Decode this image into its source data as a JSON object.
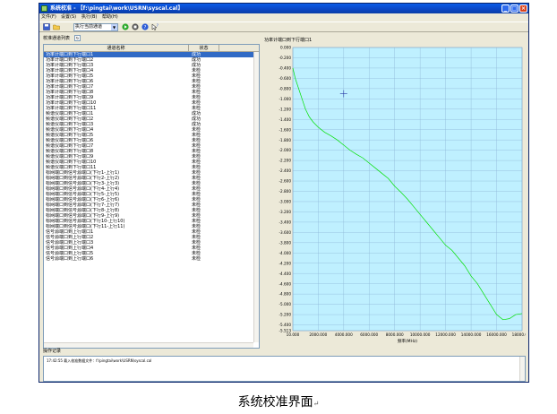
{
  "window": {
    "title": "系统校准 - 【f:\\pingtai\\work\\USRN\\syscal.cal】"
  },
  "menu": [
    {
      "label": "文件(F)"
    },
    {
      "label": "设置(S)"
    },
    {
      "label": "执行(B)"
    },
    {
      "label": "帮助(H)"
    }
  ],
  "toolbar": {
    "mode_value": "执行当前通道",
    "run_icon": "play-icon",
    "stop_icon": "stop-icon",
    "help_icon": "help-icon"
  },
  "list": {
    "group_label": "校准通道列表",
    "columns": {
      "name": "通道名称",
      "status": "状态"
    },
    "rows": [
      {
        "name": "功率计端口到下行端口1",
        "status": "成功"
      },
      {
        "name": "功率计端口到下行端口2",
        "status": "成功"
      },
      {
        "name": "功率计端口到下行端口3",
        "status": "成功"
      },
      {
        "name": "功率计端口到下行端口4",
        "status": "未检"
      },
      {
        "name": "功率计端口到下行端口5",
        "status": "未检"
      },
      {
        "name": "功率计端口到下行端口6",
        "status": "未检"
      },
      {
        "name": "功率计端口到下行端口7",
        "status": "未检"
      },
      {
        "name": "功率计端口到下行端口8",
        "status": "未检"
      },
      {
        "name": "功率计端口到下行端口9",
        "status": "未检"
      },
      {
        "name": "功率计端口到下行端口10",
        "status": "未检"
      },
      {
        "name": "功率计端口到下行端口11",
        "status": "未检"
      },
      {
        "name": "频谱仪端口到下行端口1",
        "status": "成功"
      },
      {
        "name": "频谱仪端口到下行端口2",
        "status": "成功"
      },
      {
        "name": "频谱仪端口到下行端口3",
        "status": "成功"
      },
      {
        "name": "频谱仪端口到下行端口4",
        "status": "未检"
      },
      {
        "name": "频谱仪端口到下行端口5",
        "status": "未检"
      },
      {
        "name": "频谱仪端口到下行端口6",
        "status": "未检"
      },
      {
        "name": "频谱仪端口到下行端口7",
        "status": "未检"
      },
      {
        "name": "频谱仪端口到下行端口8",
        "status": "未检"
      },
      {
        "name": "频谱仪端口到下行端口9",
        "status": "未检"
      },
      {
        "name": "频谱仪端口到下行端口10",
        "status": "未检"
      },
      {
        "name": "频谱仪端口到下行端口11",
        "status": "未检"
      },
      {
        "name": "标网端口到信号源端口(下行1-上行1)",
        "status": "未检"
      },
      {
        "name": "标网端口到信号源端口(下行2-上行2)",
        "status": "未检"
      },
      {
        "name": "标网端口到信号源端口(下行3-上行3)",
        "status": "未检"
      },
      {
        "name": "标网端口到信号源端口(下行4-上行4)",
        "status": "未检"
      },
      {
        "name": "标网端口到信号源端口(下行5-上行5)",
        "status": "未检"
      },
      {
        "name": "标网端口到信号源端口(下行6-上行6)",
        "status": "未检"
      },
      {
        "name": "标网端口到信号源端口(下行7-上行7)",
        "status": "未检"
      },
      {
        "name": "标网端口到信号源端口(下行8-上行8)",
        "status": "未检"
      },
      {
        "name": "标网端口到信号源端口(下行9-上行9)",
        "status": "未检"
      },
      {
        "name": "标网端口到信号源端口(下行10-上行10)",
        "status": "未检"
      },
      {
        "name": "标网端口到信号源端口(下行11-上行11)",
        "status": "未检"
      },
      {
        "name": "信号源端口到上行端口1",
        "status": "未检"
      },
      {
        "name": "信号源端口到上行端口2",
        "status": "未检"
      },
      {
        "name": "信号源端口到上行端口3",
        "status": "未检"
      },
      {
        "name": "信号源端口到上行端口4",
        "status": "未检"
      },
      {
        "name": "信号源端口到上行端口5",
        "status": "未检"
      },
      {
        "name": "信号源端口到上行端口6",
        "status": "未检"
      }
    ]
  },
  "chart_title": "功率计端口到下行端口1",
  "chart_data": {
    "type": "line",
    "xlabel": "频率(MHz)",
    "ylabel": "",
    "xlim": [
      10,
      18000
    ],
    "ylim": [
      -5.513,
      0
    ],
    "x_ticks": [
      10,
      2000,
      4000,
      6000,
      8000,
      10000,
      12000,
      14000,
      16000,
      18000
    ],
    "x_tick_labels": [
      "10.000",
      "2000.000",
      "4000.000",
      "6000.000",
      "8000.000",
      "10000.000",
      "12000.000",
      "14000.000",
      "16000.000",
      "18000.000"
    ],
    "y_ticks": [
      0,
      -0.2,
      -0.4,
      -0.6,
      -0.8,
      -1.0,
      -1.2,
      -1.4,
      -1.6,
      -1.8,
      -2.0,
      -2.2,
      -2.4,
      -2.6,
      -2.8,
      -3.0,
      -3.2,
      -3.4,
      -3.6,
      -3.8,
      -4.0,
      -4.2,
      -4.4,
      -4.6,
      -4.8,
      -5.0,
      -5.2,
      -5.4,
      -5.513
    ],
    "y_tick_labels": [
      "0.000",
      "-0.200",
      "-0.400",
      "-0.600",
      "-0.800",
      "-1.000",
      "-1.200",
      "-1.400",
      "-1.600",
      "-1.800",
      "-2.000",
      "-2.200",
      "-2.400",
      "-2.600",
      "-2.800",
      "-3.000",
      "-3.200",
      "-3.400",
      "-3.600",
      "-3.800",
      "-4.000",
      "-4.200",
      "-4.400",
      "-4.600",
      "-4.800",
      "-5.000",
      "-5.200",
      "-5.400",
      "-5.513"
    ],
    "grid": true,
    "line_color": "#00e000",
    "background_color": "#bff0ff",
    "marker": {
      "x": 4000,
      "y": -0.9
    },
    "series": [
      {
        "x": [
          10,
          200,
          400,
          600,
          800,
          1000,
          1300,
          1600,
          2000,
          2500,
          3000,
          3500,
          4000,
          4500,
          5000,
          5500,
          6000,
          6500,
          7000,
          7500,
          8000,
          8500,
          9000,
          9500,
          10000,
          10500,
          11000,
          11500,
          12000,
          12500,
          13000,
          13500,
          14000,
          14500,
          15000,
          15500,
          16000,
          16500,
          17000,
          17500,
          18000
        ],
        "y": [
          -0.4,
          -0.6,
          -0.75,
          -0.9,
          -1.05,
          -1.2,
          -1.35,
          -1.45,
          -1.55,
          -1.65,
          -1.72,
          -1.8,
          -1.9,
          -2.0,
          -2.08,
          -2.15,
          -2.25,
          -2.35,
          -2.45,
          -2.55,
          -2.7,
          -2.82,
          -2.95,
          -3.1,
          -3.25,
          -3.4,
          -3.55,
          -3.7,
          -3.85,
          -3.95,
          -4.1,
          -4.25,
          -4.45,
          -4.6,
          -4.8,
          -5.0,
          -5.2,
          -5.3,
          -5.28,
          -5.2,
          -5.18
        ]
      }
    ]
  },
  "log": {
    "label": "操作记录",
    "lines": [
      "17:42:55  载入校准数据文件：f:\\pingtai\\work\\USRN\\syscal.cal"
    ]
  },
  "caption": "系统校准界面",
  "caption_mark": "↵"
}
